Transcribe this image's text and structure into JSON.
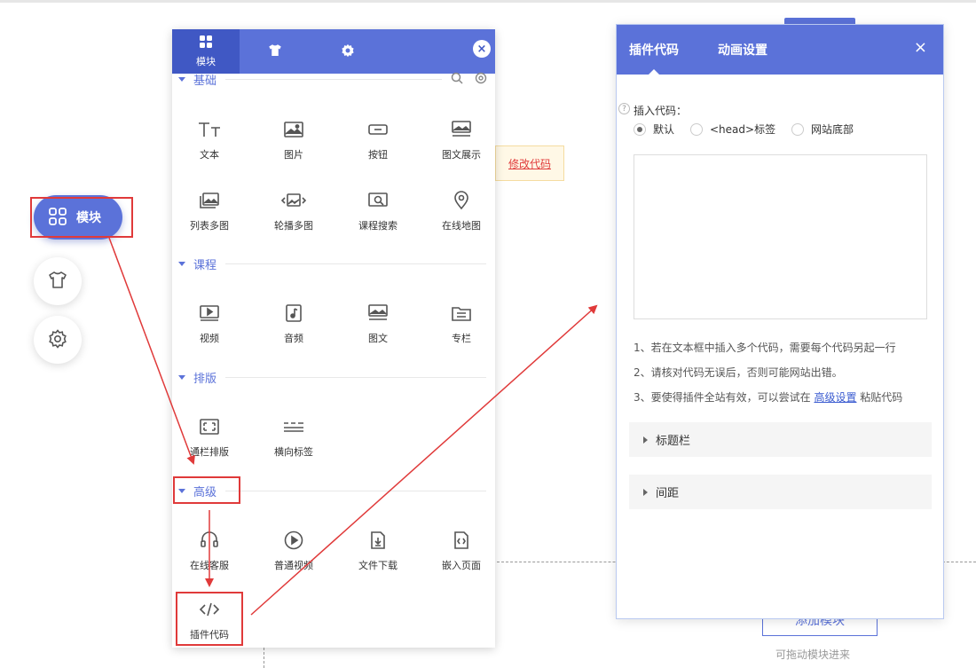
{
  "sidebar": {
    "module_label": "模块"
  },
  "module_panel": {
    "tabs": [
      {
        "label": "模块",
        "icon": "grid-icon"
      },
      {
        "label": "",
        "icon": "shirt-icon"
      },
      {
        "label": "",
        "icon": "gear-icon"
      }
    ],
    "close_label": "×",
    "sections": [
      {
        "name": "基础",
        "items": [
          {
            "label": "文本",
            "icon": "text-icon"
          },
          {
            "label": "图片",
            "icon": "image-icon"
          },
          {
            "label": "按钮",
            "icon": "button-icon"
          },
          {
            "label": "图文展示",
            "icon": "image-text-icon"
          },
          {
            "label": "列表多图",
            "icon": "list-images-icon"
          },
          {
            "label": "轮播多图",
            "icon": "carousel-icon"
          },
          {
            "label": "课程搜索",
            "icon": "course-search-icon"
          },
          {
            "label": "在线地图",
            "icon": "map-pin-icon"
          }
        ]
      },
      {
        "name": "课程",
        "items": [
          {
            "label": "视频",
            "icon": "video-icon"
          },
          {
            "label": "音频",
            "icon": "audio-icon"
          },
          {
            "label": "图文",
            "icon": "article-icon"
          },
          {
            "label": "专栏",
            "icon": "column-icon"
          }
        ]
      },
      {
        "name": "排版",
        "items": [
          {
            "label": "通栏排版",
            "icon": "fullwidth-icon"
          },
          {
            "label": "横向标签",
            "icon": "horizontal-tabs-icon"
          }
        ]
      },
      {
        "name": "高级",
        "items": [
          {
            "label": "在线客服",
            "icon": "headset-icon"
          },
          {
            "label": "普通视频",
            "icon": "play-circle-icon"
          },
          {
            "label": "文件下载",
            "icon": "file-download-icon"
          },
          {
            "label": "嵌入页面",
            "icon": "embed-page-icon"
          },
          {
            "label": "插件代码",
            "icon": "code-icon"
          }
        ]
      }
    ]
  },
  "background": {
    "modify_code_link": "修改代码",
    "add_module_button": "添加模块",
    "drag_hint": "可拖动模块进来"
  },
  "code_panel": {
    "tabs": [
      "插件代码",
      "动画设置"
    ],
    "close_label": "×",
    "insert_label": "插入代码：",
    "options": [
      {
        "label": "默认",
        "selected": true
      },
      {
        "label": "<head>标签",
        "selected": false
      },
      {
        "label": "网站底部",
        "selected": false
      }
    ],
    "code_value": "",
    "notes": [
      "1、若在文本框中插入多个代码，需要每个代码另起一行",
      "2、请核对代码无误后，否则可能网站出错。"
    ],
    "note3_prefix": "3、要使得插件全站有效，可以尝试在 ",
    "note3_link": "高级设置",
    "note3_suffix": " 粘贴代码",
    "collapsibles": [
      "标题栏",
      "间距"
    ]
  },
  "colors": {
    "primary": "#5b72d9",
    "primary_dark": "#4058c4",
    "annotation_red": "#e03a3a"
  }
}
